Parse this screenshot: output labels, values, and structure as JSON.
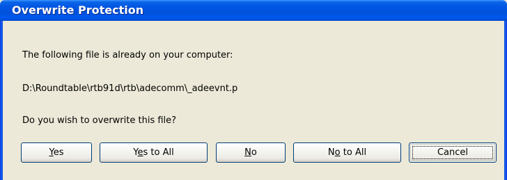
{
  "window": {
    "title": "Overwrite Protection"
  },
  "message": {
    "line1": "The following file is already on your computer:",
    "file_path": "D:\\Roundtable\\rtb91d\\rtb\\adecomm\\_adeevnt.p",
    "question": "Do you wish to overwrite this file?"
  },
  "buttons": {
    "yes": {
      "pre": "",
      "accel": "Y",
      "post": "es"
    },
    "yes_to_all": {
      "pre": "Y",
      "accel": "e",
      "post": "s to All"
    },
    "no": {
      "pre": "",
      "accel": "N",
      "post": "o"
    },
    "no_to_all": {
      "pre": "N",
      "accel": "o",
      "post": " to All"
    },
    "cancel": {
      "label": "Cancel",
      "focused": true
    }
  },
  "colors": {
    "title_bar": "#0055e3",
    "dialog_face": "#ece9d8",
    "button_border": "#003c74"
  }
}
